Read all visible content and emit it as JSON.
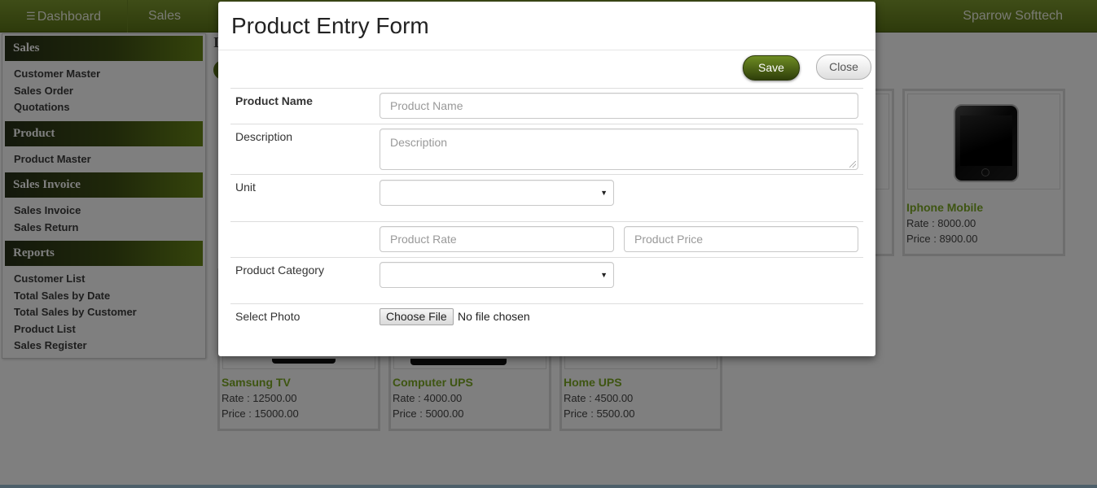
{
  "topbar": {
    "dashboard_label": "Dashboard",
    "sales_label": "Sales",
    "brand": "Sparrow Softtech"
  },
  "sidebar": {
    "sections": [
      {
        "title": "Sales",
        "items": [
          "Customer Master",
          "Sales Order",
          "Quotations"
        ]
      },
      {
        "title": "Product",
        "items": [
          "Product Master"
        ]
      },
      {
        "title": "Sales Invoice",
        "items": [
          "Sales Invoice",
          "Sales Return"
        ]
      },
      {
        "title": "Reports",
        "items": [
          "Customer List",
          "Total Sales by Date",
          "Total Sales by Customer",
          "Product List",
          "Sales Register"
        ]
      }
    ]
  },
  "main": {
    "heading_initial": "I"
  },
  "products": [
    {
      "name": "Iphone Mobile",
      "rate": "Rate : 8000.00",
      "price": "Price : 8900.00"
    },
    {
      "name": "Samsung TV",
      "rate": "Rate : 12500.00",
      "price": "Price : 15000.00"
    },
    {
      "name": "Computer UPS",
      "rate": "Rate : 4000.00",
      "price": "Price : 5000.00"
    },
    {
      "name": "Home UPS",
      "rate": "Rate : 4500.00",
      "price": "Price : 5500.00"
    }
  ],
  "modal": {
    "title": "Product Entry Form",
    "save_label": "Save",
    "close_label": "Close",
    "fields": {
      "product_name_label": "Product Name",
      "product_name_placeholder": "Product Name",
      "description_label": "Description",
      "description_placeholder": "Description",
      "unit_label": "Unit",
      "unit_value": "",
      "product_rate_placeholder": "Product Rate",
      "product_price_placeholder": "Product Price",
      "product_category_label": "Product Category",
      "product_category_value": "",
      "select_photo_label": "Select Photo",
      "choose_file_label": "Choose File",
      "file_status": "No file chosen"
    }
  },
  "colors": {
    "accent_green": "#5c7517",
    "product_title_green": "#7daa24",
    "save_button": "#4b6415"
  }
}
